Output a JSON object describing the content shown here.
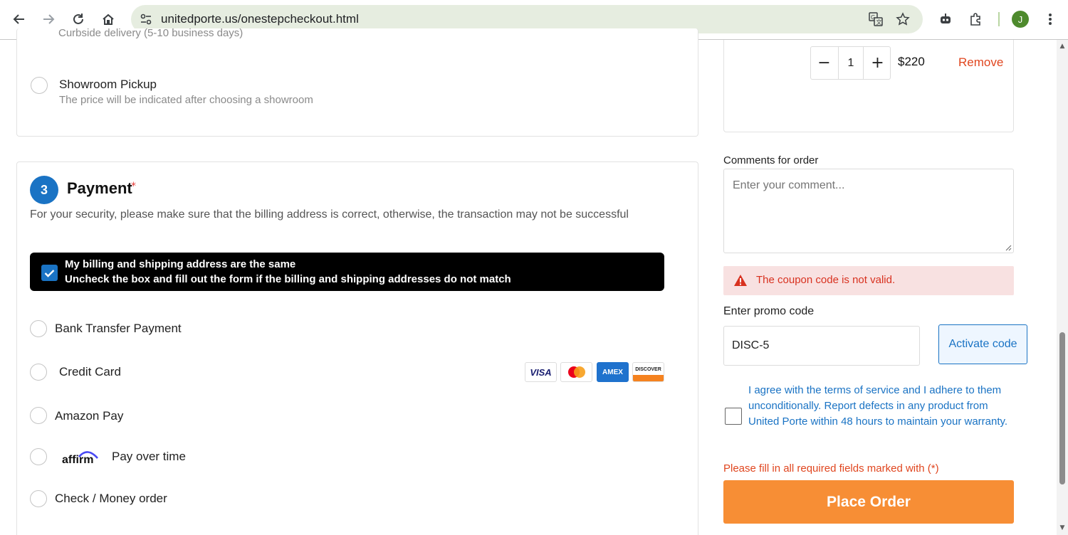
{
  "browser": {
    "url": "unitedporte.us/onestepcheckout.html",
    "avatar_initial": "J"
  },
  "shipping": {
    "clipped_text": "Curbside delivery (5-10 business days)",
    "showroom_label": "Showroom Pickup",
    "showroom_sub": "The price will be indicated after choosing a showroom"
  },
  "payment": {
    "step_number": "3",
    "title": "Payment",
    "required_mark": "*",
    "security_note": "For your security, please make sure that the billing address is correct, otherwise, the transaction may not be successful",
    "same_address_line1": "My billing and shipping address are the same",
    "same_address_line2": "Uncheck the box and fill out the form if the billing and shipping addresses do not match",
    "same_address_checked": true,
    "options": {
      "bank": "Bank Transfer Payment",
      "credit": "Credit Card",
      "amazon": "Amazon Pay",
      "affirm_logo": "affirm",
      "affirm": "Pay over time",
      "check": "Check / Money order"
    },
    "card_logos": {
      "visa": "VISA",
      "amex": "AMEX",
      "discover": "DISCOVER"
    }
  },
  "cart": {
    "qty_minus": "−",
    "qty_value": "1",
    "qty_plus": "+",
    "price": "$220",
    "remove_label": "Remove"
  },
  "comments": {
    "label": "Comments for order",
    "placeholder": "Enter your comment..."
  },
  "coupon_error": "The coupon code is not valid.",
  "promo": {
    "label": "Enter promo code",
    "value": "DISC-5",
    "button": "Activate code"
  },
  "terms": "I agree with the terms of service and I adhere to them unconditionally. Report defects in any product from United Porte within 48 hours to maintain your warranty.",
  "required_note": "Please fill in all required fields marked with (*)",
  "place_order": "Place Order",
  "colors": {
    "accent_blue": "#1a73c4",
    "order_orange": "#f78e35",
    "error_red": "#d8311f",
    "error_bg": "#f8e1e1"
  }
}
